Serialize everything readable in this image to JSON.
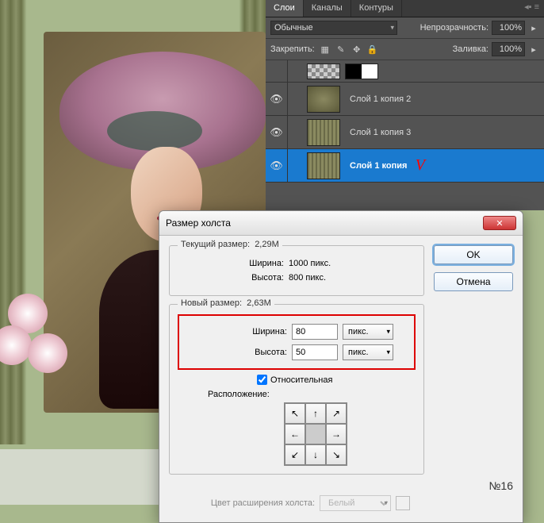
{
  "layersPanel": {
    "tabs": {
      "layers": "Слои",
      "channels": "Каналы",
      "paths": "Контуры"
    },
    "blendMode": "Обычные",
    "opacityLabel": "Непрозрачность:",
    "opacityValue": "100%",
    "lockLabel": "Закрепить:",
    "fillLabel": "Заливка:",
    "fillValue": "100%",
    "layers": [
      {
        "name": "",
        "type": "mask"
      },
      {
        "name": "Слой 1 копия 2",
        "type": "pattern"
      },
      {
        "name": "Слой 1 копия 3",
        "type": "stripes"
      },
      {
        "name": "Слой 1 копия",
        "type": "stripes",
        "selected": true
      }
    ],
    "marker": "V"
  },
  "dialog": {
    "title": "Размер холста",
    "current": {
      "legend": "Текущий размер:",
      "size": "2,29M",
      "widthLabel": "Ширина:",
      "widthValue": "1000 пикс.",
      "heightLabel": "Высота:",
      "heightValue": "800 пикс."
    },
    "new": {
      "legend": "Новый размер:",
      "size": "2,63M",
      "widthLabel": "Ширина:",
      "widthValue": "80",
      "heightLabel": "Высота:",
      "heightValue": "50",
      "unit": "пикс.",
      "relativeLabel": "Относительная",
      "anchorLabel": "Расположение:"
    },
    "extensionLabel": "Цвет расширения холста:",
    "extensionValue": "Белый",
    "buttons": {
      "ok": "OK",
      "cancel": "Отмена"
    },
    "number": "№16"
  }
}
